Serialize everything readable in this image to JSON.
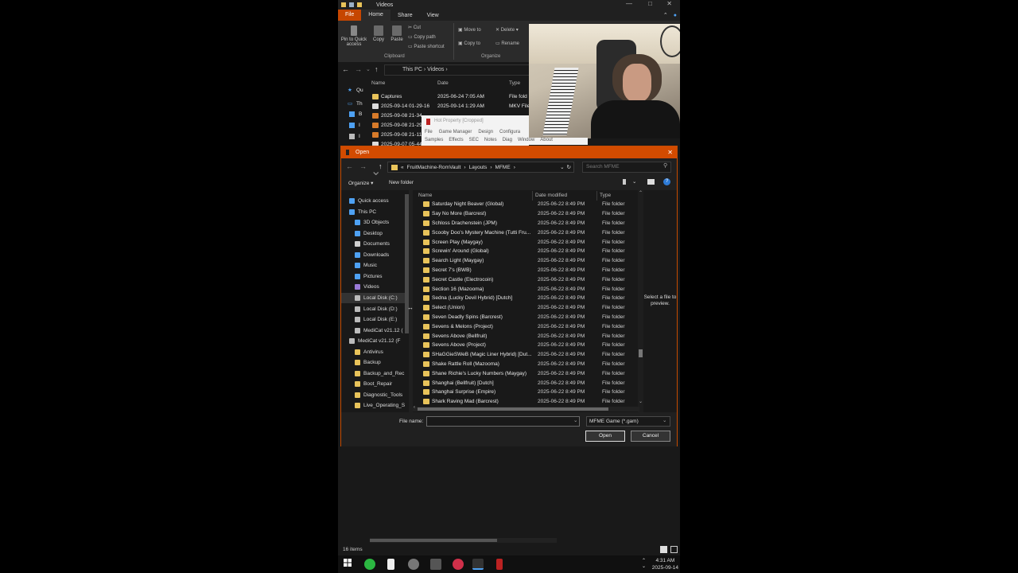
{
  "explorer": {
    "window_title": "Videos",
    "tabs": [
      "File",
      "Home",
      "Share",
      "View"
    ],
    "ribbon": {
      "pin_label": "Pin to Quick access",
      "copy_label": "Copy",
      "paste_label": "Paste",
      "cut_label": "Cut",
      "copy_path_label": "Copy path",
      "paste_shortcut_label": "Paste shortcut",
      "clipboard_group": "Clipboard",
      "move_to_label": "Move to",
      "copy_to_label": "Copy to",
      "delete_label": "Delete",
      "rename_label": "Rename",
      "organize_group": "Organize"
    },
    "breadcrumb": [
      "This PC",
      "Videos"
    ],
    "columns": {
      "name": "Name",
      "date": "Date",
      "type": "Type"
    },
    "rows": [
      {
        "name": "Captures",
        "date": "2025-06-24 7:05 AM",
        "type": "File fold",
        "icon": "folder"
      },
      {
        "name": "2025-09-14 01-29-16",
        "date": "2025-09-14 1:29 AM",
        "type": "MKV File",
        "icon": "mkv"
      },
      {
        "name": "2025-09-08 21-34",
        "date": "",
        "type": "",
        "icon": "vlc"
      },
      {
        "name": "2025-09-08 21-29",
        "date": "",
        "type": "",
        "icon": "vlc"
      },
      {
        "name": "2025-09-08 21-11",
        "date": "",
        "type": "",
        "icon": "vlc"
      },
      {
        "name": "2025-09-07 05-44",
        "date": "",
        "type": "",
        "icon": "mkv"
      }
    ],
    "side_labels": [
      "Qu",
      "Th",
      "B",
      "I",
      "I"
    ]
  },
  "hot_property": {
    "title": "Hot Property [Cropped]",
    "menu1": [
      "File",
      "Game Manager",
      "Design",
      "Configura"
    ],
    "menu2": [
      "Samples",
      "Effects",
      "SEC",
      "Notes",
      "Diag",
      "Window",
      "About"
    ]
  },
  "dialog": {
    "title": "Open",
    "path": [
      "FruitMachine-RomVault",
      "Layouts",
      "MFME"
    ],
    "search_placeholder": "Search MFME",
    "organize_label": "Organize ▾",
    "new_folder_label": "New folder",
    "nav": [
      {
        "label": "Quick access",
        "icon": "star",
        "indent": 0
      },
      {
        "label": "This PC",
        "icon": "pc",
        "indent": 0
      },
      {
        "label": "3D Objects",
        "icon": "cube",
        "indent": 1
      },
      {
        "label": "Desktop",
        "icon": "desktop",
        "indent": 1
      },
      {
        "label": "Documents",
        "icon": "doc",
        "indent": 1
      },
      {
        "label": "Downloads",
        "icon": "download",
        "indent": 1
      },
      {
        "label": "Music",
        "icon": "music",
        "indent": 1
      },
      {
        "label": "Pictures",
        "icon": "pictures",
        "indent": 1
      },
      {
        "label": "Videos",
        "icon": "videos",
        "indent": 1
      },
      {
        "label": "Local Disk (C:)",
        "icon": "drive",
        "indent": 1
      },
      {
        "label": "Local Disk (D:)",
        "icon": "drive",
        "indent": 1
      },
      {
        "label": "Local Disk (E:)",
        "icon": "drive",
        "indent": 1
      },
      {
        "label": "MediCat v21.12 (",
        "icon": "usb",
        "indent": 1
      },
      {
        "label": "MediCat v21.12 (F",
        "icon": "usb",
        "indent": 0
      },
      {
        "label": "Antivirus",
        "icon": "folder",
        "indent": 1
      },
      {
        "label": "Backup",
        "icon": "folder",
        "indent": 1
      },
      {
        "label": "Backup_and_Rec",
        "icon": "folder",
        "indent": 1
      },
      {
        "label": "Boot_Repair",
        "icon": "folder",
        "indent": 1
      },
      {
        "label": "Diagnostic_Tools",
        "icon": "folder",
        "indent": 1
      },
      {
        "label": "Live_Operating_S",
        "icon": "folder",
        "indent": 1
      }
    ],
    "columns": {
      "name": "Name",
      "date": "Date modified",
      "type": "Type"
    },
    "files": [
      {
        "name": "Saturday Night Beaver (Global)",
        "date": "2025-06-22 8:49 PM",
        "type": "File folder"
      },
      {
        "name": "Say No More (Barcrest)",
        "date": "2025-06-22 8:49 PM",
        "type": "File folder"
      },
      {
        "name": "Schloss Drachenstein (JPM)",
        "date": "2025-06-22 8:49 PM",
        "type": "File folder"
      },
      {
        "name": "Scooby Doo's Mystery Machine (Tutti Fru...",
        "date": "2025-06-22 8:49 PM",
        "type": "File folder"
      },
      {
        "name": "Screen Play (Maygay)",
        "date": "2025-06-22 8:49 PM",
        "type": "File folder"
      },
      {
        "name": "Screwin' Around (Global)",
        "date": "2025-06-22 8:49 PM",
        "type": "File folder"
      },
      {
        "name": "Search Light (Maygay)",
        "date": "2025-06-22 8:49 PM",
        "type": "File folder"
      },
      {
        "name": "Secret 7's (BWB)",
        "date": "2025-06-22 8:49 PM",
        "type": "File folder"
      },
      {
        "name": "Secret Castle (Electrocoin)",
        "date": "2025-06-22 8:49 PM",
        "type": "File folder"
      },
      {
        "name": "Section 16 (Mazooma)",
        "date": "2025-06-22 8:49 PM",
        "type": "File folder"
      },
      {
        "name": "Sedna (Lucky Devil Hybrid) [Dutch]",
        "date": "2025-06-22 8:49 PM",
        "type": "File folder"
      },
      {
        "name": "Select (Union)",
        "date": "2025-06-22 8:49 PM",
        "type": "File folder"
      },
      {
        "name": "Seven Deadly Spins (Barcrest)",
        "date": "2025-06-22 8:49 PM",
        "type": "File folder"
      },
      {
        "name": "Sevens & Melons (Project)",
        "date": "2025-06-22 8:49 PM",
        "type": "File folder"
      },
      {
        "name": "Sevens Above (Bellfruit)",
        "date": "2025-06-22 8:49 PM",
        "type": "File folder"
      },
      {
        "name": "Sevens Above (Project)",
        "date": "2025-06-22 8:49 PM",
        "type": "File folder"
      },
      {
        "name": "SHaGGieSWeB (Magic Liner Hybrid) [Dut...",
        "date": "2025-06-22 8:49 PM",
        "type": "File folder"
      },
      {
        "name": "Shake Rattle Roll (Mazooma)",
        "date": "2025-06-22 8:49 PM",
        "type": "File folder"
      },
      {
        "name": "Shane Richie's Lucky Numbers (Maygay)",
        "date": "2025-06-22 8:49 PM",
        "type": "File folder"
      },
      {
        "name": "Shanghai (Bellfruit) [Dutch]",
        "date": "2025-06-22 8:49 PM",
        "type": "File folder"
      },
      {
        "name": "Shanghai Surprise (Empire)",
        "date": "2025-06-22 8:49 PM",
        "type": "File folder"
      },
      {
        "name": "Shark Raving Mad (Barcrest)",
        "date": "2025-06-22 8:49 PM",
        "type": "File folder"
      }
    ],
    "preview_text": "Select a file to preview.",
    "file_name_label": "File name:",
    "file_name_value": "",
    "file_type": "MFME Game (*.gam)",
    "open_label": "Open",
    "cancel_label": "Cancel"
  },
  "status": {
    "items_count": "16 items"
  },
  "taskbar": {
    "time": "4:31 AM",
    "date": "2025-09-14"
  },
  "colors": {
    "accent": "#d24b00",
    "folder": "#e8c35a",
    "dark_bg": "#191919"
  }
}
